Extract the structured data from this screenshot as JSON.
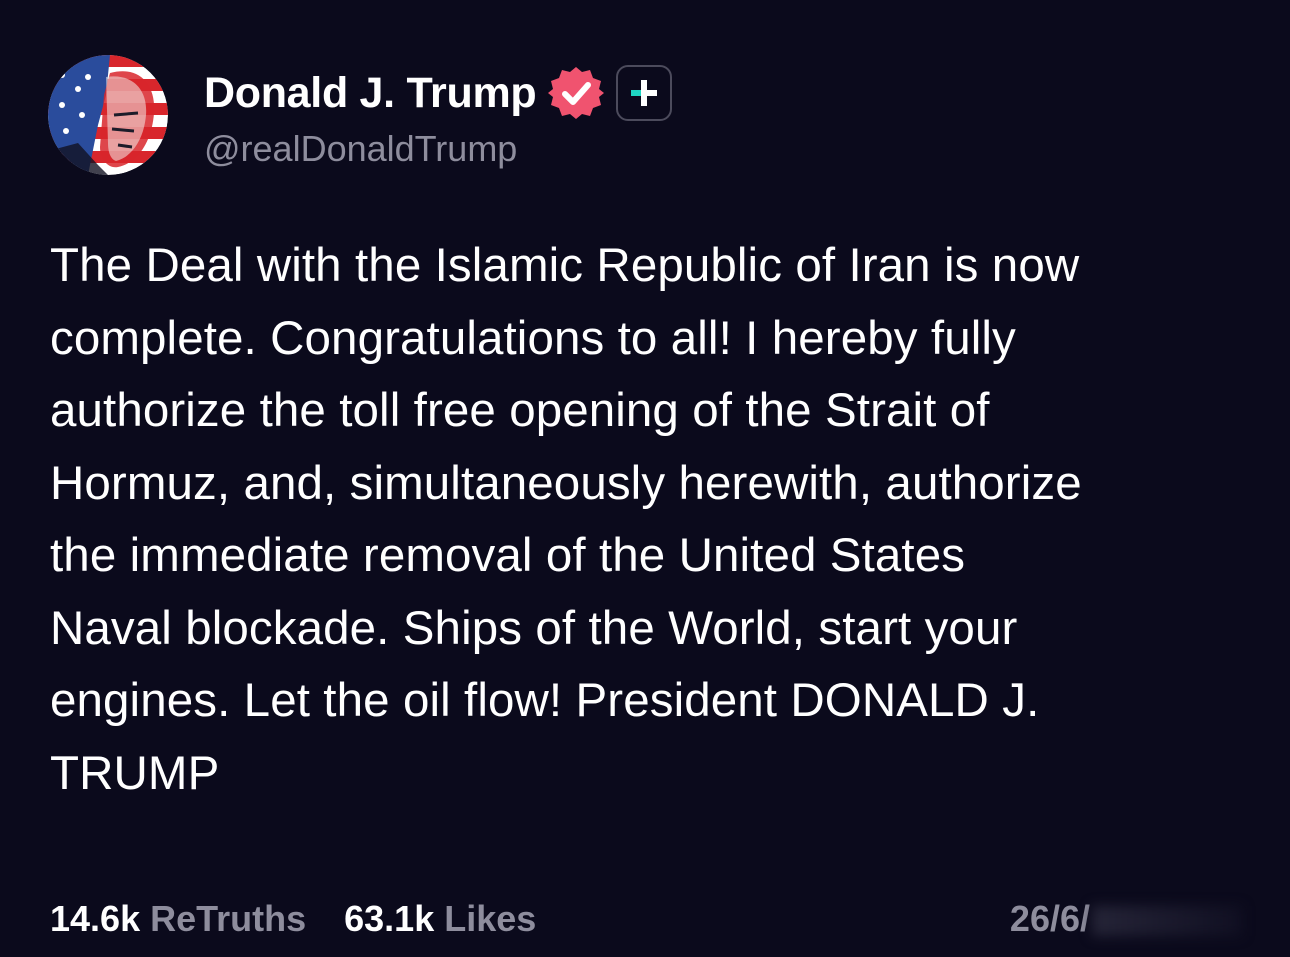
{
  "author": {
    "name": "Donald J. Trump",
    "handle": "@realDonaldTrump"
  },
  "badges": {
    "verified_icon": "verified-badge-icon",
    "follow_icon": "plus-icon",
    "verified_color": "#f0536f",
    "follow_color": "#1ed6c3"
  },
  "post": {
    "text": "The Deal with the Islamic Republic of Iran is now\ncomplete. Congratulations to all! I hereby fully\nauthorize the toll free opening of the Strait of\nHormuz, and, simultaneously herewith, authorize\nthe immediate removal of the United States\nNaval blockade. Ships of the World, start your\nengines. Let the oil flow! President DONALD J.\nTRUMP"
  },
  "stats": {
    "retruths_count": "14.6k",
    "retruths_label": "ReTruths",
    "likes_count": "63.1k",
    "likes_label": "Likes"
  },
  "date": {
    "visible_text": "26/6/"
  },
  "colors": {
    "background": "#0b0a1c",
    "muted_text": "#8e8d9d"
  }
}
